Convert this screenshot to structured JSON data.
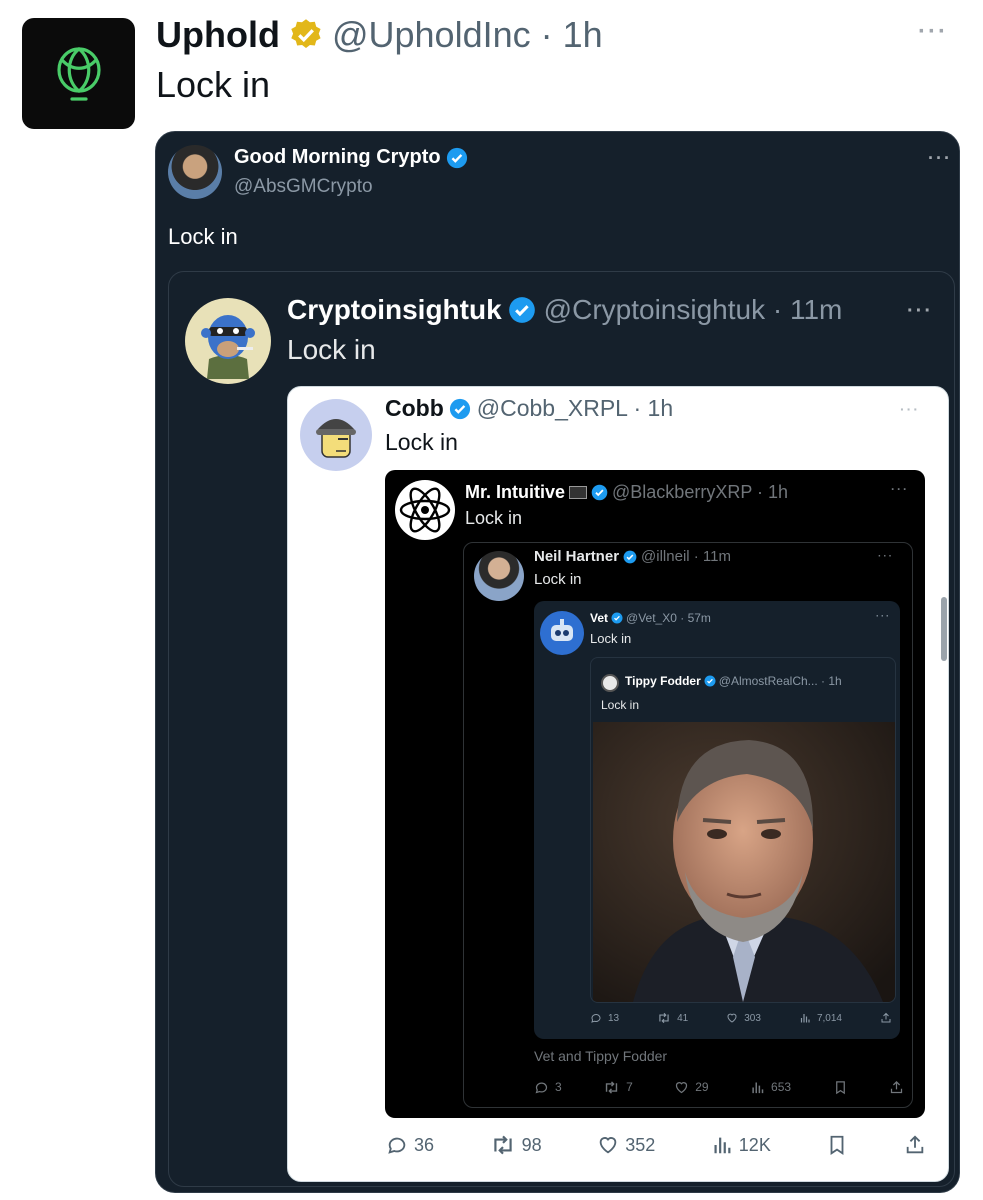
{
  "top": {
    "name": "Uphold",
    "handle_meta": "@UpholdInc · 1h",
    "text": "Lock in",
    "more": "···"
  },
  "level1": {
    "name": "Good Morning Crypto",
    "handle": "@AbsGMCrypto",
    "text": "Lock in",
    "more": "···"
  },
  "level2": {
    "name": "Cryptoinsightuk",
    "handle_meta": "@Cryptoinsightuk · 11m",
    "text": "Lock in",
    "more": "···"
  },
  "level3": {
    "name": "Cobb",
    "handle_meta": "@Cobb_XRPL · 1h",
    "text": "Lock in",
    "more": "···",
    "actions": {
      "replies": "36",
      "reposts": "98",
      "likes": "352",
      "views": "12K"
    }
  },
  "level4": {
    "name": "Mr. Intuitive",
    "flag": "🏴‍☠️",
    "handle_meta": "@BlackberryXRP · 1h",
    "text": "Lock in",
    "more": "···"
  },
  "level5": {
    "name": "Neil Hartner",
    "handle_meta": "@illneil · 11m",
    "text": "Lock in",
    "more": "···",
    "caption": "Vet and Tippy Fodder",
    "actions": {
      "replies": "3",
      "reposts": "7",
      "likes": "29",
      "views": "653"
    }
  },
  "level6": {
    "name": "Vet",
    "handle_meta": "@Vet_X0 · 57m",
    "text": "Lock in",
    "more": "···",
    "actions": {
      "replies": "13",
      "reposts": "41",
      "likes": "303",
      "views": "7,014"
    }
  },
  "level7": {
    "name": "Tippy Fodder",
    "handle_meta": "@AlmostRealCh... · 1h",
    "text": "Lock in"
  },
  "colors": {
    "verified_blue": "#1d9bf0",
    "verified_gold": "#e2b719",
    "dark_bg": "#15202b",
    "uphold_green": "#49cc68"
  }
}
